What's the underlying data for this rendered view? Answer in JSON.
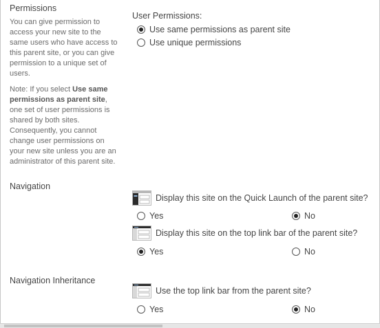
{
  "permissions": {
    "title": "Permissions",
    "description": "You can give permission to access your new site to the same users who have access to this parent site, or you can give permission to a unique set of users.",
    "note_prefix": "Note: If you select ",
    "note_bold": "Use same permissions as parent site",
    "note_suffix": ", one set of user permissions is shared by both sites. Consequently, you cannot change user permissions on your new site unless you are an administrator of this parent site.",
    "field_label": "User Permissions:",
    "options": [
      {
        "label": "Use same permissions as parent site",
        "checked": true
      },
      {
        "label": "Use unique permissions",
        "checked": false
      }
    ]
  },
  "navigation": {
    "title": "Navigation",
    "quick_launch": {
      "icon": "quick-launch-layout-icon",
      "question": "Display this site on the Quick Launch of the parent site?",
      "yes_label": "Yes",
      "no_label": "No",
      "selected": "No"
    },
    "top_link_bar": {
      "icon": "top-link-bar-layout-icon",
      "question": "Display this site on the top link bar of the parent site?",
      "yes_label": "Yes",
      "no_label": "No",
      "selected": "Yes"
    }
  },
  "navigation_inheritance": {
    "title": "Navigation Inheritance",
    "use_parent_bar": {
      "icon": "top-link-bar-layout-icon",
      "question": "Use the top link bar from the parent site?",
      "yes_label": "Yes",
      "no_label": "No",
      "selected": "No"
    }
  },
  "colors": {
    "icon_dark": "#2b2b2b",
    "icon_blue": "#3a6ea5",
    "icon_light": "#b8b8b8"
  }
}
